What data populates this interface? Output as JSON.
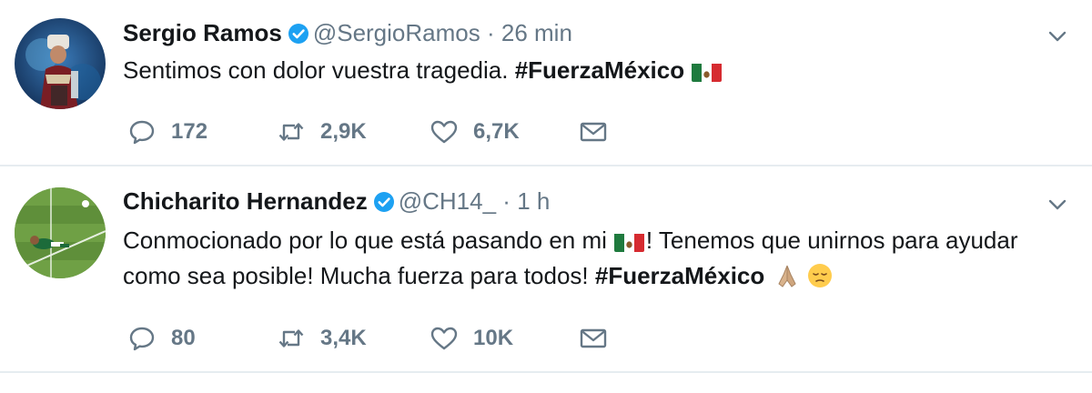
{
  "tweets": [
    {
      "author_name": "Sergio Ramos",
      "handle": "@SergioRamos",
      "separator": "·",
      "time": "26 min",
      "text_before_hashtag": "Sentimos con dolor vuestra tragedia. ",
      "hashtag": "#FuerzaMéxico",
      "text_after_hashtag": "",
      "emojis": [
        "mexico-flag"
      ],
      "replies": "172",
      "retweets": "2,9K",
      "likes": "6,7K"
    },
    {
      "author_name": "Chicharito Hernandez",
      "handle": "@CH14_",
      "separator": "·",
      "time": "1 h",
      "text_part1": "Conmocionado por lo que está pasando en mi",
      "text_part2": "! Tenemos que unirnos para ayudar como sea posible! Mucha fuerza para todos! ",
      "hashtag": "#FuerzaMéxico",
      "emojis": [
        "mexico-flag",
        "folded-hands",
        "pensive-face"
      ],
      "replies": "80",
      "retweets": "3,4K",
      "likes": "10K"
    }
  ],
  "colors": {
    "text": "#14171a",
    "secondary": "#657786",
    "verified": "#1da1f2",
    "divider": "#e6ecf0"
  }
}
